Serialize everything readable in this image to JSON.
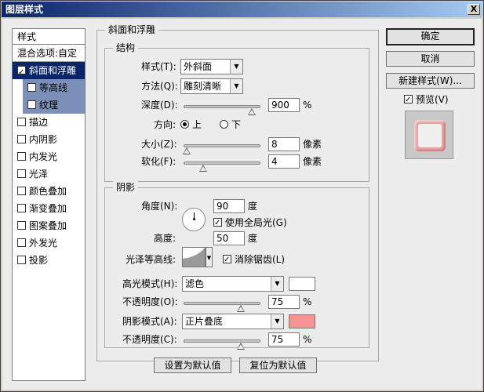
{
  "window": {
    "title": "图层样式",
    "close": "X"
  },
  "left_panel": {
    "header": "样式",
    "blend_options": "混合选项:自定",
    "items": [
      {
        "label": "斜面和浮雕",
        "checked": true,
        "selected": true
      },
      {
        "label": "等高线",
        "checked": false,
        "sub": true
      },
      {
        "label": "纹理",
        "checked": false,
        "sub": true
      },
      {
        "label": "描边",
        "checked": false
      },
      {
        "label": "内阴影",
        "checked": false
      },
      {
        "label": "内发光",
        "checked": false
      },
      {
        "label": "光泽",
        "checked": false
      },
      {
        "label": "颜色叠加",
        "checked": false
      },
      {
        "label": "渐变叠加",
        "checked": false
      },
      {
        "label": "图案叠加",
        "checked": false
      },
      {
        "label": "外发光",
        "checked": false
      },
      {
        "label": "投影",
        "checked": false
      }
    ]
  },
  "bevel": {
    "title": "斜面和浮雕",
    "structure": {
      "title": "结构",
      "style_label": "样式(T):",
      "style_value": "外斜面",
      "technique_label": "方法(Q):",
      "technique_value": "雕刻清晰",
      "depth_label": "深度(D):",
      "depth_value": "900",
      "depth_unit": "%",
      "depth_fraction": 0.9,
      "direction_label": "方向:",
      "dir_up": "上",
      "dir_down": "下",
      "size_label": "大小(Z):",
      "size_value": "8",
      "size_unit": "像素",
      "size_fraction": 0.03,
      "soften_label": "软化(F):",
      "soften_value": "4",
      "soften_unit": "像素",
      "soften_fraction": 0.25
    },
    "shading": {
      "title": "阴影",
      "angle_label": "角度(N):",
      "angle_value": "90",
      "angle_unit": "度",
      "global_light_label": "使用全局光(G)",
      "altitude_label": "高度:",
      "altitude_value": "50",
      "altitude_unit": "度",
      "gloss_contour_label": "光泽等高线:",
      "antialias_label": "消除锯齿(L)",
      "highlight_mode_label": "高光模式(H):",
      "highlight_mode_value": "滤色",
      "highlight_color": "#ffffff",
      "highlight_opacity_label": "不透明度(O):",
      "highlight_opacity_value": "75",
      "highlight_opacity_unit": "%",
      "highlight_opacity_fraction": 0.75,
      "shadow_mode_label": "阴影模式(A):",
      "shadow_mode_value": "正片叠底",
      "shadow_color": "#f69393",
      "shadow_opacity_label": "不透明度(C):",
      "shadow_opacity_value": "75",
      "shadow_opacity_unit": "%",
      "shadow_opacity_fraction": 0.75
    },
    "make_default": "设置为默认值",
    "reset_default": "复位为默认值"
  },
  "right": {
    "ok": "确定",
    "cancel": "取消",
    "new_style": "新建样式(W)...",
    "preview_label": "预览(V)"
  }
}
